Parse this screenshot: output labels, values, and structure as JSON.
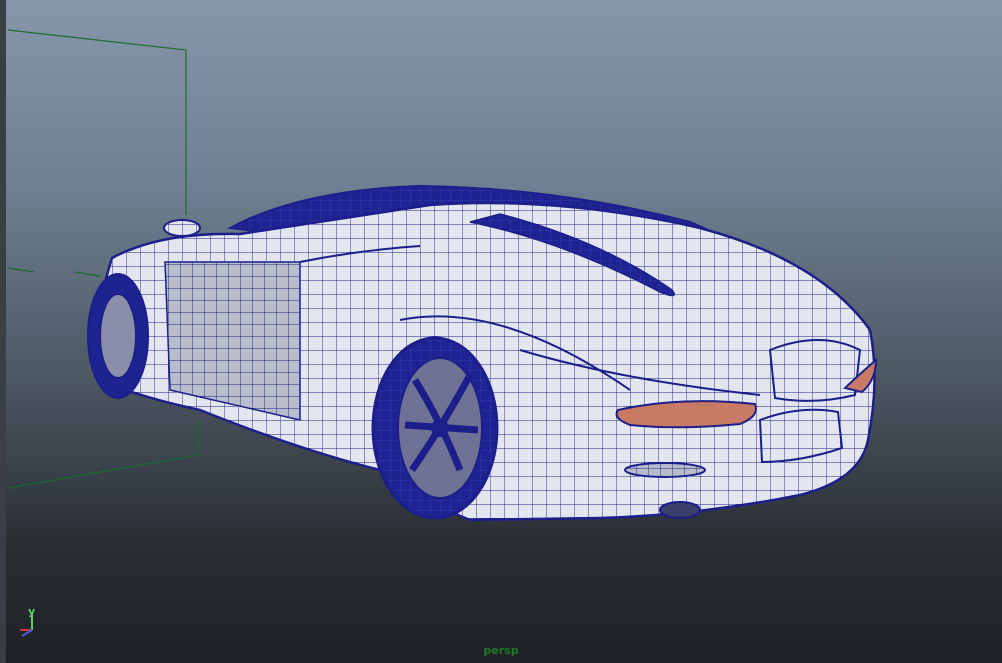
{
  "viewport": {
    "camera_name": "persp",
    "axis_label_y": "y",
    "colors": {
      "wire": "#1c1f8a",
      "surface": "#e4e6ef",
      "grid_line": "#1d6b2e",
      "camera_label": "#1f7a2a",
      "taillight": "#c97a64",
      "axis_x": "#d23a3a",
      "axis_y": "#5fd15f",
      "axis_z": "#4a5ae0"
    }
  }
}
